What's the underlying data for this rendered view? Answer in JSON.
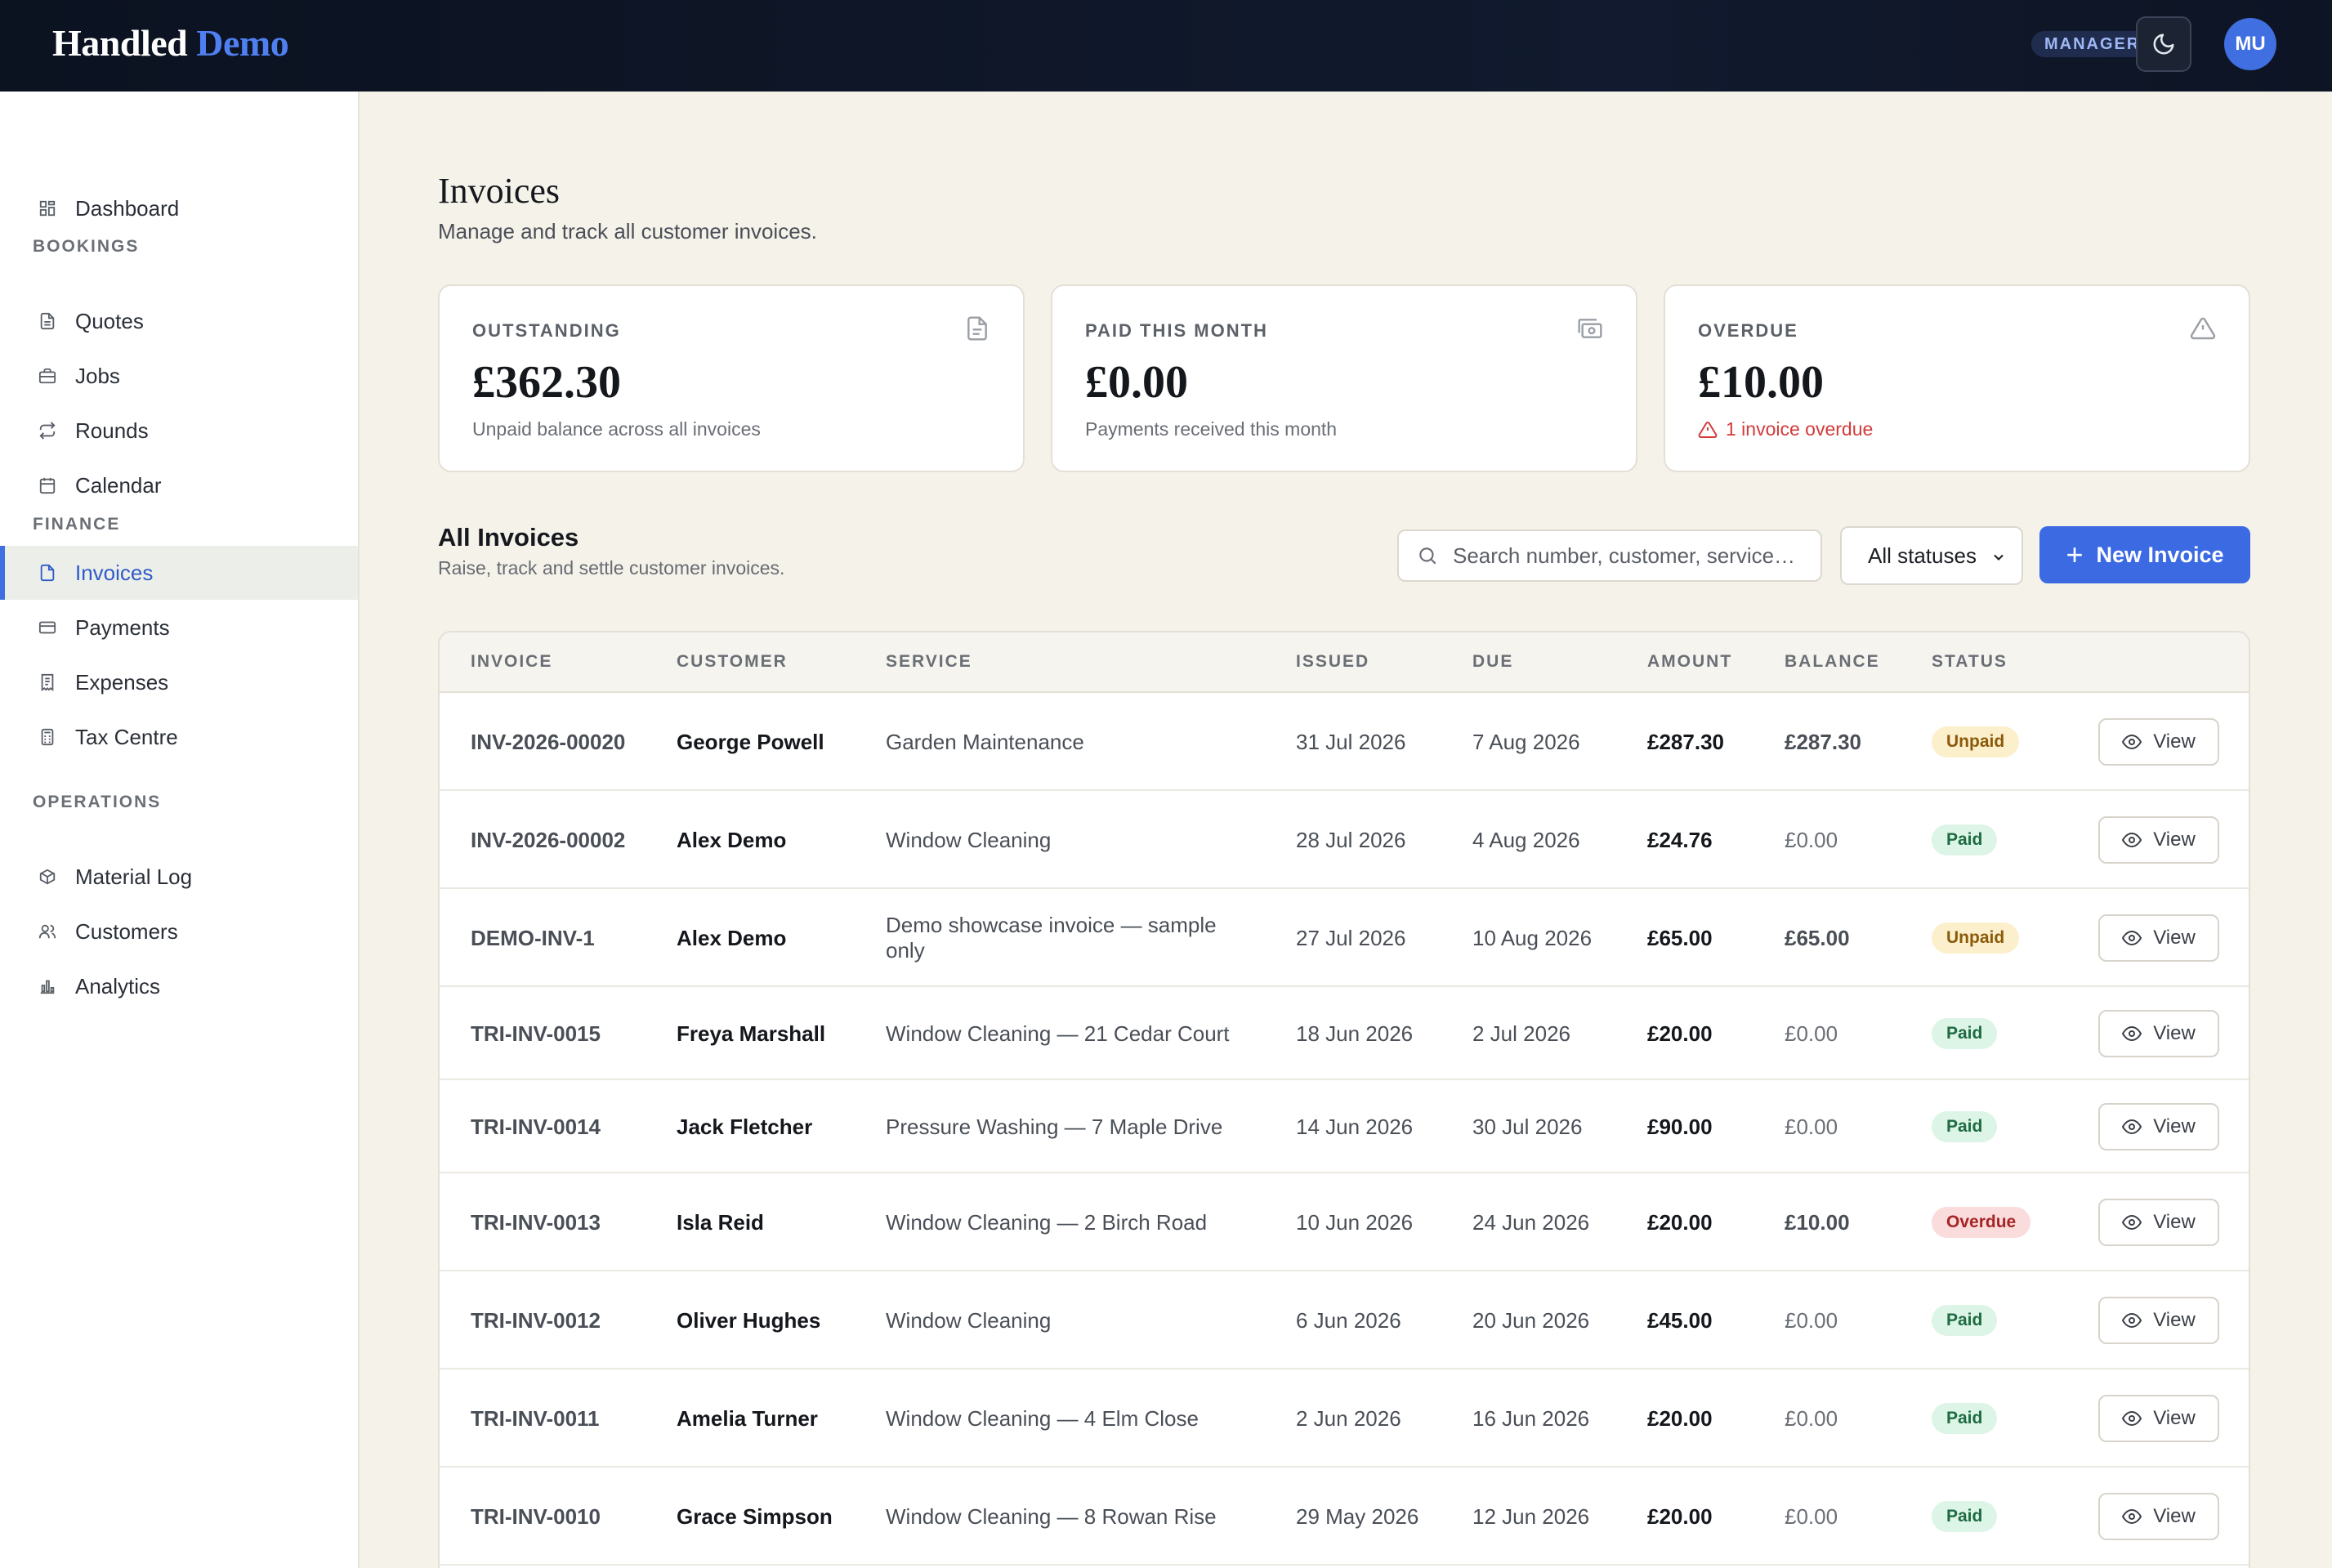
{
  "app": {
    "brand_main": "Handled",
    "brand_accent": "Demo",
    "role_badge": "MANAGER",
    "avatar_initials": "MU"
  },
  "sidebar": {
    "top_item": {
      "label": "Dashboard",
      "icon": "dashboard-icon"
    },
    "sections": [
      {
        "title": "BOOKINGS",
        "items": [
          {
            "label": "Quotes",
            "icon": "document-icon"
          },
          {
            "label": "Jobs",
            "icon": "briefcase-icon"
          },
          {
            "label": "Rounds",
            "icon": "repeat-icon"
          },
          {
            "label": "Calendar",
            "icon": "calendar-icon"
          }
        ]
      },
      {
        "title": "FINANCE",
        "items": [
          {
            "label": "Invoices",
            "icon": "file-icon",
            "active": true
          },
          {
            "label": "Payments",
            "icon": "card-icon"
          },
          {
            "label": "Expenses",
            "icon": "receipt-icon"
          },
          {
            "label": "Tax Centre",
            "icon": "calculator-icon"
          }
        ]
      },
      {
        "title": "OPERATIONS",
        "items": [
          {
            "label": "Material Log",
            "icon": "package-icon"
          },
          {
            "label": "Customers",
            "icon": "users-icon"
          },
          {
            "label": "Analytics",
            "icon": "bar-chart-icon"
          }
        ]
      }
    ]
  },
  "header": {
    "title": "Invoices",
    "subtitle": "Manage and track all customer invoices."
  },
  "stats": [
    {
      "label": "OUTSTANDING",
      "value": "£362.30",
      "note": "Unpaid balance across all invoices",
      "icon": "file-icon"
    },
    {
      "label": "PAID THIS MONTH",
      "value": "£0.00",
      "note": "Payments received this month",
      "icon": "cash-icon"
    },
    {
      "label": "OVERDUE",
      "value": "£10.00",
      "note": "1 invoice overdue",
      "icon": "warning-icon"
    }
  ],
  "list": {
    "title": "All Invoices",
    "subtitle": "Raise, track and settle customer invoices.",
    "search_placeholder": "Search number, customer, service…",
    "status_filter": "All statuses",
    "new_button": "New Invoice",
    "view_label": "View",
    "columns": [
      "INVOICE",
      "CUSTOMER",
      "SERVICE",
      "ISSUED",
      "DUE",
      "AMOUNT",
      "BALANCE",
      "STATUS"
    ]
  },
  "invoices": [
    {
      "number": "INV-2026-00020",
      "customer": "George Powell",
      "service": "Garden Maintenance",
      "issued": "31 Jul 2026",
      "due": "7 Aug 2026",
      "amount": "£287.30",
      "balance": "£287.30",
      "status": "Unpaid"
    },
    {
      "number": "INV-2026-00002",
      "customer": "Alex Demo",
      "service": "Window Cleaning",
      "issued": "28 Jul 2026",
      "due": "4 Aug 2026",
      "amount": "£24.76",
      "balance": "£0.00",
      "status": "Paid"
    },
    {
      "number": "DEMO-INV-1",
      "customer": "Alex Demo",
      "service": "Demo showcase invoice — sample only",
      "issued": "27 Jul 2026",
      "due": "10 Aug 2026",
      "amount": "£65.00",
      "balance": "£65.00",
      "status": "Unpaid"
    },
    {
      "number": "TRI-INV-0015",
      "customer": "Freya Marshall",
      "service": "Window Cleaning — 21 Cedar Court",
      "issued": "18 Jun 2026",
      "due": "2 Jul 2026",
      "amount": "£20.00",
      "balance": "£0.00",
      "status": "Paid"
    },
    {
      "number": "TRI-INV-0014",
      "customer": "Jack Fletcher",
      "service": "Pressure Washing — 7 Maple Drive",
      "issued": "14 Jun 2026",
      "due": "30 Jul 2026",
      "amount": "£90.00",
      "balance": "£0.00",
      "status": "Paid"
    },
    {
      "number": "TRI-INV-0013",
      "customer": "Isla Reid",
      "service": "Window Cleaning — 2 Birch Road",
      "issued": "10 Jun 2026",
      "due": "24 Jun 2026",
      "amount": "£20.00",
      "balance": "£10.00",
      "status": "Overdue"
    },
    {
      "number": "TRI-INV-0012",
      "customer": "Oliver Hughes",
      "service": "Window Cleaning",
      "issued": "6 Jun 2026",
      "due": "20 Jun 2026",
      "amount": "£45.00",
      "balance": "£0.00",
      "status": "Paid"
    },
    {
      "number": "TRI-INV-0011",
      "customer": "Amelia Turner",
      "service": "Window Cleaning — 4 Elm Close",
      "issued": "2 Jun 2026",
      "due": "16 Jun 2026",
      "amount": "£20.00",
      "balance": "£0.00",
      "status": "Paid"
    },
    {
      "number": "TRI-INV-0010",
      "customer": "Grace Simpson",
      "service": "Window Cleaning — 8 Rowan Rise",
      "issued": "29 May 2026",
      "due": "12 Jun 2026",
      "amount": "£20.00",
      "balance": "£0.00",
      "status": "Paid"
    }
  ],
  "colors": {
    "accent": "#3b6ae3",
    "paid": "#1f6b43",
    "unpaid": "#8a5a0a",
    "overdue": "#a62424"
  }
}
